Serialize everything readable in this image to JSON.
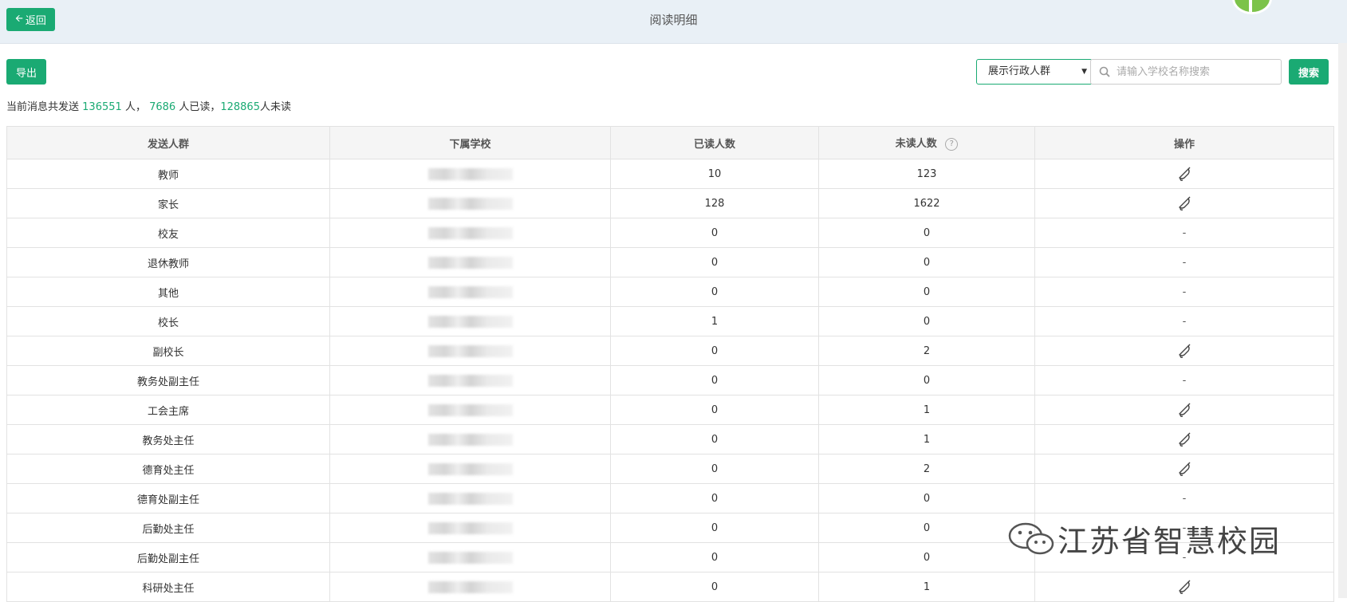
{
  "header": {
    "back_label": "返回",
    "title": "阅读明细"
  },
  "toolbar": {
    "export_label": "导出",
    "filter_selected": "展示行政人群",
    "search_placeholder": "请输入学校名称搜索",
    "search_label": "搜索"
  },
  "summary": {
    "prefix": "当前消息共发送",
    "total": "136551",
    "total_unit": "人，",
    "read": "7686",
    "read_unit": "人已读，",
    "unread": "128865",
    "unread_unit": "人未读"
  },
  "table": {
    "columns": [
      "发送人群",
      "下属学校",
      "已读人数",
      "未读人数",
      "操作"
    ],
    "rows": [
      {
        "group": "教师",
        "read": "10",
        "unread": "123",
        "action": "bell"
      },
      {
        "group": "家长",
        "read": "128",
        "unread": "1622",
        "action": "bell"
      },
      {
        "group": "校友",
        "read": "0",
        "unread": "0",
        "action": "-"
      },
      {
        "group": "退休教师",
        "read": "0",
        "unread": "0",
        "action": "-"
      },
      {
        "group": "其他",
        "read": "0",
        "unread": "0",
        "action": "-"
      },
      {
        "group": "校长",
        "read": "1",
        "unread": "0",
        "action": "-"
      },
      {
        "group": "副校长",
        "read": "0",
        "unread": "2",
        "action": "bell"
      },
      {
        "group": "教务处副主任",
        "read": "0",
        "unread": "0",
        "action": "-"
      },
      {
        "group": "工会主席",
        "read": "0",
        "unread": "1",
        "action": "bell"
      },
      {
        "group": "教务处主任",
        "read": "0",
        "unread": "1",
        "action": "bell"
      },
      {
        "group": "德育处主任",
        "read": "0",
        "unread": "2",
        "action": "bell"
      },
      {
        "group": "德育处副主任",
        "read": "0",
        "unread": "0",
        "action": "-"
      },
      {
        "group": "后勤处主任",
        "read": "0",
        "unread": "0",
        "action": "-"
      },
      {
        "group": "后勤处副主任",
        "read": "0",
        "unread": "0",
        "action": "-"
      },
      {
        "group": "科研处主任",
        "read": "0",
        "unread": "1",
        "action": "bell"
      }
    ]
  },
  "watermark": {
    "text": "江苏省智慧校园"
  },
  "colors": {
    "accent": "#1aaa73",
    "header_bg": "#e9f0f6"
  },
  "icons": {
    "back": "arrow-left-icon",
    "search": "search-icon",
    "help": "question-circle-icon",
    "remind": "bell-icon"
  }
}
